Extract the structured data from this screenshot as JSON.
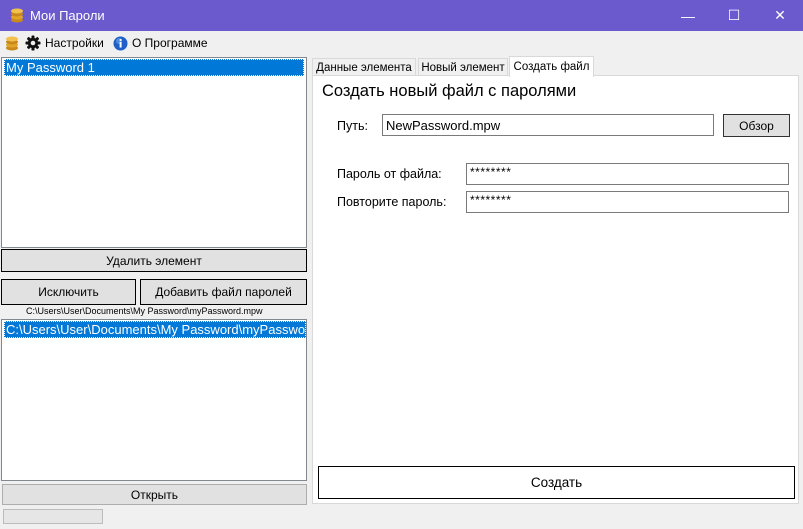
{
  "window": {
    "title": "Мои Пароли",
    "minimize_glyph": "—",
    "maximize_glyph": "☐",
    "close_glyph": "✕",
    "titlebar_color": "#6a5acd"
  },
  "menu": {
    "settings_label": "Настройки",
    "about_label": "О Программе"
  },
  "left_panel": {
    "items": [
      "My Password 1"
    ],
    "delete_button": "Удалить элемент",
    "exclude_button": "Исключить",
    "add_file_button": "Добавить файл паролей",
    "current_path": "C:\\Users\\User\\Documents\\My Password\\myPassword.mpw",
    "files": [
      "C:\\Users\\User\\Documents\\My Password\\myPassword.mpw"
    ],
    "open_button": "Открыть"
  },
  "tabs": [
    "Данные элемента",
    "Новый элемент",
    "Создать файл"
  ],
  "active_tab": "Создать файл",
  "create_file": {
    "heading": "Создать новый файл с паролями",
    "path_label": "Путь:",
    "path_value": "NewPassword.mpw",
    "browse_button": "Обзор",
    "password_label": "Пароль от файла:",
    "password_value": "********",
    "repeat_label": "Повторите пароль:",
    "repeat_value": "********",
    "create_button": "Создать"
  },
  "colors": {
    "selection": "#0078d7",
    "button_face": "#e1e1e1"
  }
}
